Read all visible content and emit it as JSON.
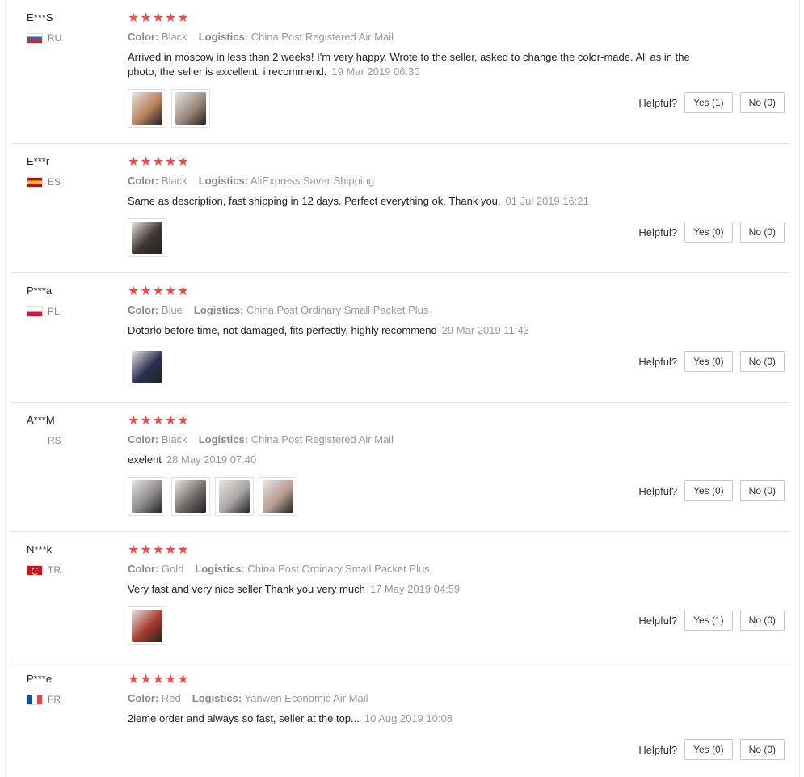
{
  "helpful_label": "Helpful?",
  "color_label": "Color:",
  "logistics_label": "Logistics:",
  "star_glyphs": "★★★★★",
  "reviews": [
    {
      "user": "E***S",
      "country": "RU",
      "flag_colors": [
        "#ffffff",
        "#3a5fbf",
        "#d52b1e"
      ],
      "flag_type": "h3",
      "rating": 5,
      "color": "Black",
      "logistics": "China Post Registered Air Mail",
      "text": "Arrived in moscow in less than 2 weeks! I'm very happy. Wrote to the seller, asked to change the color-made. All as in the photo, the seller is excellent, i recommend.",
      "date": "19 Mar 2019 06:30",
      "photos": [
        "#b7825b",
        "#9a8a7a"
      ],
      "yes": "Yes (1)",
      "no": "No (0)"
    },
    {
      "user": "E***r",
      "country": "ES",
      "flag_colors": [
        "#c60b1e",
        "#ffc400",
        "#c60b1e"
      ],
      "flag_type": "h3",
      "rating": 5,
      "color": "Black",
      "logistics": "AliExpress Saver Shipping",
      "text": "Same as description, fast shipping in 12 days. Perfect everything ok. Thank you.",
      "date": "01 Jul 2019 16:21",
      "photos": [
        "#3d3530"
      ],
      "yes": "Yes (0)",
      "no": "No (0)"
    },
    {
      "user": "P***a",
      "country": "PL",
      "flag_colors": [
        "#ffffff",
        "#dc143c"
      ],
      "flag_type": "h2",
      "rating": 5,
      "color": "Blue",
      "logistics": "China Post Ordinary Small Packet Plus",
      "text": "Dotarło before time, not damaged, fits perfectly, highly recommend",
      "date": "29 Mar 2019 11:43",
      "photos": [
        "#2a3050"
      ],
      "yes": "Yes (0)",
      "no": "No (0)"
    },
    {
      "user": "A***M",
      "country": "RS",
      "flag_colors": [],
      "flag_type": "none",
      "rating": 5,
      "color": "Black",
      "logistics": "China Post Registered Air Mail",
      "text": "exelent",
      "date": "28 May 2019 07:40",
      "photos": [
        "#8c8a88",
        "#6e6a66",
        "#a8a6a4",
        "#b89c90"
      ],
      "yes": "Yes (0)",
      "no": "No (0)"
    },
    {
      "user": "N***k",
      "country": "TR",
      "flag_colors": [
        "#e30a17",
        "#ffffff"
      ],
      "flag_type": "tr",
      "rating": 5,
      "color": "Gold",
      "logistics": "China Post Ordinary Small Packet Plus",
      "text": "Very fast and very nice seller Thank you very much",
      "date": "17 May 2019 04:59",
      "photos": [
        "#a43a2c"
      ],
      "yes": "Yes (1)",
      "no": "No (0)"
    },
    {
      "user": "P***e",
      "country": "FR",
      "flag_colors": [
        "#0055a4",
        "#ffffff",
        "#ef4135"
      ],
      "flag_type": "v3",
      "rating": 5,
      "color": "Red",
      "logistics": "Yanwen Economic Air Mail",
      "text": "2ieme order and always so fast, seller at the top...",
      "date": "10 Aug 2019 10:08",
      "photos": [],
      "yes": "Yes (0)",
      "no": "No (0)"
    }
  ]
}
